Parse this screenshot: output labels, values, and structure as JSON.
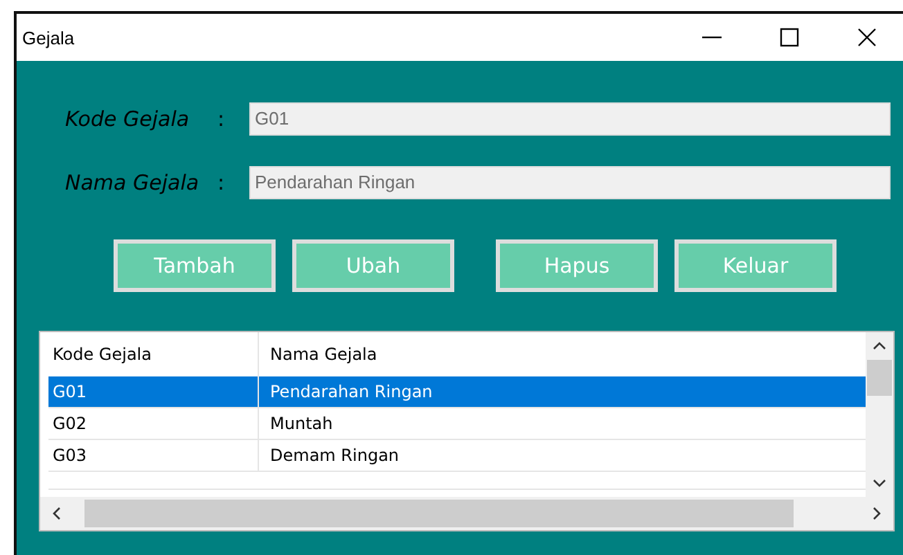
{
  "window": {
    "title": "Gejala"
  },
  "form": [
    {
      "label": "Kode Gejala",
      "colon": ":",
      "value": "G01"
    },
    {
      "label": "Nama Gejala",
      "colon": ":",
      "value": "Pendarahan Ringan"
    }
  ],
  "buttons": [
    "Tambah",
    "Ubah",
    "Hapus",
    "Keluar"
  ],
  "table": {
    "columns": [
      "Kode Gejala",
      "Nama Gejala"
    ],
    "rows": [
      {
        "cells": [
          "G01",
          "Pendarahan Ringan"
        ],
        "selected": true
      },
      {
        "cells": [
          "G02",
          "Muntah"
        ],
        "selected": false
      },
      {
        "cells": [
          "G03",
          "Demam Ringan"
        ],
        "selected": false
      }
    ]
  }
}
